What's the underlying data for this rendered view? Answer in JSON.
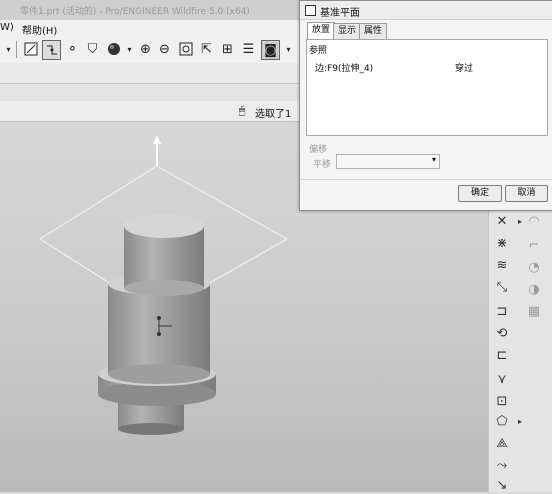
{
  "menu": {
    "partial_item": "W)",
    "help": "帮助(H)"
  },
  "titlebar": {
    "blurred_text": "零件1.prt  (活动的) - Pro/ENGINEER Wildfire 5.0 (x64)"
  },
  "selection": {
    "status": "选取了1"
  },
  "dialog": {
    "title": "基准平面",
    "tabs": [
      "放置",
      "显示",
      "属性"
    ],
    "section_label": "参照",
    "reference_item": "边:F9(拉伸_4)",
    "reference_constraint": "穿过",
    "offset_section": "偏移",
    "offset_label": "平移",
    "offset_value": "",
    "ok_label": "确定",
    "cancel_label": "取消"
  },
  "colors": {
    "viewport_top": "#d7d7d7",
    "viewport_bottom": "#b9b9b9",
    "model_gray": "#a8a8a8"
  }
}
